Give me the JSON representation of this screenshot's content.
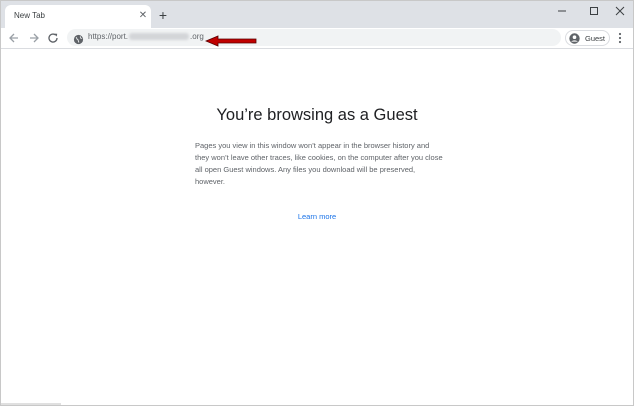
{
  "tab": {
    "title": "New Tab",
    "close_glyph": "✕"
  },
  "new_tab_glyph": "+",
  "window_controls": {
    "minimize": "—",
    "maximize": "☐",
    "close": "✕"
  },
  "omnibox": {
    "url_prefix": "https://port.",
    "url_suffix": ".org",
    "site_icon": "info-globe-icon"
  },
  "profile": {
    "label": "Guest",
    "icon": "account-circle-icon"
  },
  "page": {
    "title": "You’re browsing as a Guest",
    "body": "Pages you view in this window won’t appear in the browser history and they won’t leave other traces, like cookies, on the computer after you close all open Guest windows. Any files you download will be preserved, however.",
    "link": "Learn more"
  },
  "colors": {
    "tabstrip": "#dee1e6",
    "omnibox": "#f1f3f4",
    "link": "#1a73e8",
    "arrow": "#c00000"
  }
}
